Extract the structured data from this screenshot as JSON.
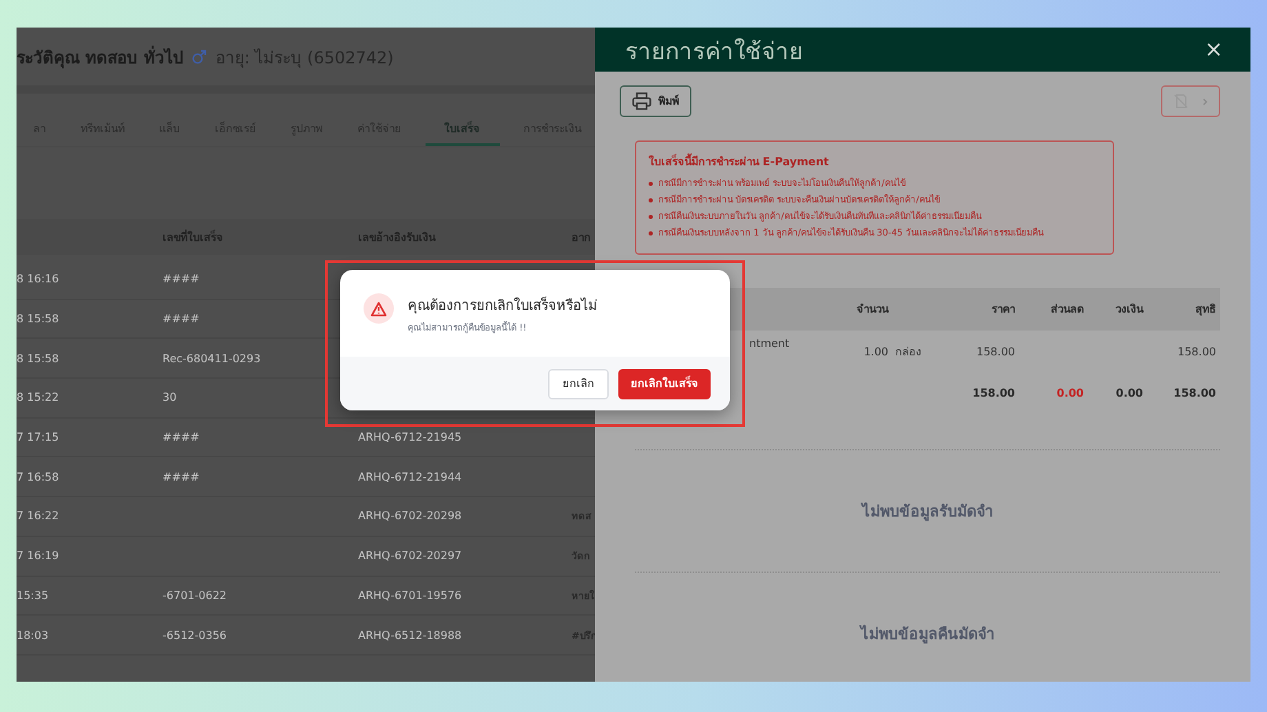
{
  "patient_header": {
    "title": "ระวัติคุณ ทดสอบ ทั่วไป",
    "age": "อายุ: ไม่ระบุ (6502742)"
  },
  "tabs": [
    {
      "label": "ลา",
      "selected": false
    },
    {
      "label": "ทรีทเม้นท์",
      "selected": false
    },
    {
      "label": "แล็บ",
      "selected": false
    },
    {
      "label": "เอ็กซเรย์",
      "selected": false
    },
    {
      "label": "รูปภาพ",
      "selected": false
    },
    {
      "label": "ค่าใช้จ่าย",
      "selected": false
    },
    {
      "label": "ใบเสร็จ",
      "selected": true
    },
    {
      "label": "การชำระเงิน",
      "selected": false
    }
  ],
  "receipts_table": {
    "columns": [
      "เลขที่ใบเสร็จ",
      "เลขอ้างอิงรับเงิน",
      "อาก"
    ],
    "rows": [
      {
        "time": "8 16:16",
        "receipt_no": "####"
      },
      {
        "time": "8 15:58",
        "receipt_no": "####"
      },
      {
        "time": "8 15:58",
        "receipt_no": "Rec-680411-0293"
      },
      {
        "time": "8 15:22",
        "receipt_no": "30"
      },
      {
        "time": "7 17:15",
        "receipt_no": "####",
        "reference_no": "ARHQ-6712-21945"
      },
      {
        "time": "7 16:58",
        "receipt_no": "####",
        "reference_no": "ARHQ-6712-21944"
      },
      {
        "time": "7 16:22",
        "reference_no": "ARHQ-6702-20298",
        "column_4": "ทดส"
      },
      {
        "time": "7 16:19",
        "reference_no": "ARHQ-6702-20297",
        "column_4": "วัดก"
      },
      {
        "time": "15:35",
        "receipt_no": "-6701-0622",
        "reference_no": "ARHQ-6701-19576",
        "column_4": "หายใ"
      },
      {
        "time": "18:03",
        "receipt_no": "-6512-0356",
        "reference_no": "ARHQ-6512-18988",
        "column_4": "#ปรึก"
      }
    ]
  },
  "expense_drawer": {
    "title": "รายการค่าใช้จ่าย",
    "close_button": "×",
    "print_button": "พิมพ์",
    "notice": {
      "title": "ใบเสร็จนี้มีการชำระผ่าน E-Payment",
      "items": [
        "กรณีมีการชำระผ่าน พร้อมเพย์ ระบบจะไม่โอนเงินคืนให้ลูกค้า/คนไข้",
        "กรณีมีการชำระผ่าน บัตรเครดิต ระบบจะคืนเงินผ่านบัตรเครดิตให้ลูกค้า/คนไข้",
        "กรณีคืนเงินระบบภายในวัน ลูกค้า/คนไข้จะได้รับเงินคืนทันทีและคลินิกได้ค่าธรรมเนียมคืน",
        "กรณีคืนเงินระบบหลังจาก 1 วัน ลูกค้า/คนไข้จะได้รับเงินคืน 30-45 วันและคลินิกจะไม่ได้ค่าธรรมเนียมคืน"
      ]
    },
    "table": {
      "columns": [
        "จำนวน",
        "ราคา",
        "ส่วนลด",
        "วงเงิน",
        "สุทธิ"
      ],
      "items": [
        {
          "name": "ntment",
          "qty": "1.00",
          "unit": "กล่อง",
          "price": "158.00",
          "net": "158.00"
        }
      ],
      "totals": {
        "price": "158.00",
        "discount": "0.00",
        "limit": "0.00",
        "net": "158.00"
      }
    },
    "deposit_received_empty": "ไม่พบข้อมูลรับมัดจำ",
    "deposit_refund_empty": "ไม่พบข้อมูลคืนมัดจำ"
  },
  "dialog": {
    "title": "คุณต้องการยกเลิกใบเสร็จหรือไม่",
    "message": "คุณไม่สามารถกู้คืนข้อมูลนี้ได้ !!",
    "buttons": [
      {
        "label": "ยกเลิก",
        "kind": "secondary"
      },
      {
        "label": "ยกเลิกใบเสร็จ",
        "kind": "danger"
      }
    ]
  }
}
